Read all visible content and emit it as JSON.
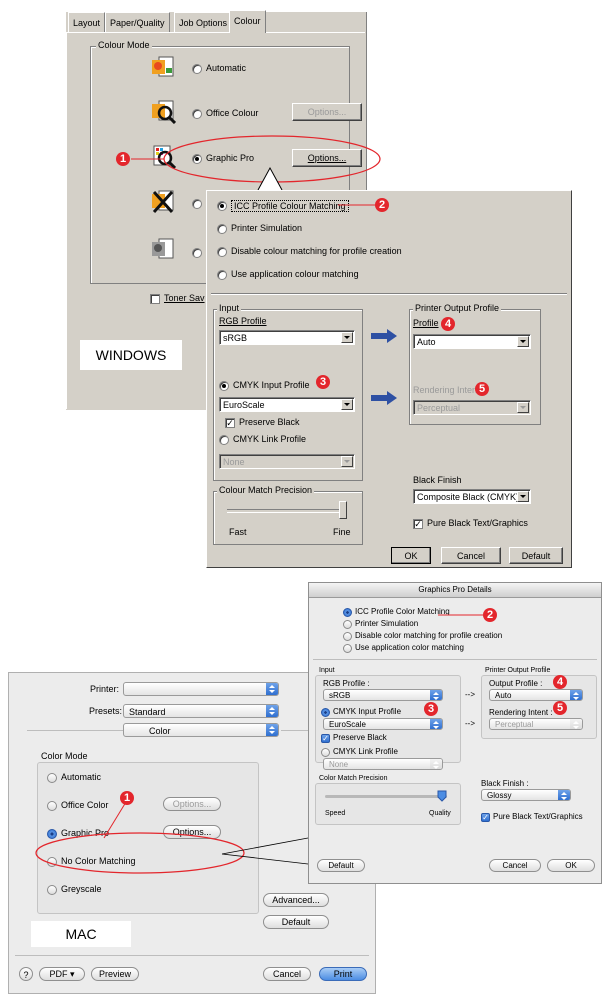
{
  "windows": {
    "tabs": [
      "Layout",
      "Paper/Quality",
      "Job Options",
      "Colour"
    ],
    "colour_mode_label": "Colour Mode",
    "automatic": "Automatic",
    "office_colour": "Office Colour",
    "graphic_pro": "Graphic Pro",
    "options": "Options...",
    "toner_saving": "Toner Sav",
    "platform_label": "WINDOWS",
    "details": {
      "icc": "ICC Profile Colour Matching",
      "printer_sim": "Printer Simulation",
      "disable": "Disable colour matching for profile creation",
      "use_app": "Use application colour matching",
      "input_label": "Input",
      "rgb_profile_label": "RGB Profile",
      "rgb_profile_value": "sRGB",
      "cmyk_input_label": "CMYK Input Profile",
      "cmyk_input_value": "EuroScale",
      "preserve_black": "Preserve Black",
      "cmyk_link_label": "CMYK Link Profile",
      "cmyk_link_value": "None",
      "precision_label": "Colour Match Precision",
      "fast": "Fast",
      "fine": "Fine",
      "output_label": "Printer Output Profile",
      "profile_label": "Profile",
      "profile_value": "Auto",
      "rendering_label": "Rendering Intent",
      "rendering_value": "Perceptual",
      "black_finish_label": "Black Finish",
      "black_finish_value": "Composite Black (CMYK)",
      "pure_black": "Pure Black Text/Graphics",
      "ok": "OK",
      "cancel": "Cancel",
      "default": "Default"
    }
  },
  "mac": {
    "details_title": "Graphics Pro Details",
    "icc": "ICC Profile Color Matching",
    "printer_sim": "Printer Simulation",
    "disable": "Disable color matching for profile creation",
    "use_app": "Use application color matching",
    "input_label": "Input",
    "rgb_profile_label": "RGB Profile :",
    "rgb_profile_value": "sRGB",
    "cmyk_input_label": "CMYK Input Profile",
    "cmyk_input_value": "EuroScale",
    "preserve_black": "Preserve Black",
    "cmyk_link_label": "CMYK Link Profile",
    "cmyk_link_value": "None",
    "arrow": "-->",
    "output_label": "Printer Output Profile",
    "output_profile_label": "Output Profile :",
    "output_profile_value": "Auto",
    "rendering_label": "Rendering Intent :",
    "rendering_value": "Perceptual",
    "precision_label": "Color Match Precision",
    "speed": "Speed",
    "quality": "Quality",
    "black_finish_label": "Black Finish :",
    "black_finish_value": "Glossy",
    "pure_black": "Pure Black Text/Graphics",
    "default": "Default",
    "cancel": "Cancel",
    "ok": "OK",
    "printer_label": "Printer:",
    "printer_value": "",
    "presets_label": "Presets:",
    "presets_value": "Standard",
    "pane_value": "Color",
    "color_mode_label": "Color Mode",
    "automatic": "Automatic",
    "office_color": "Office Color",
    "graphic_pro": "Graphic Pro",
    "no_color": "No Color Matching",
    "greyscale": "Greyscale",
    "options": "Options...",
    "advanced": "Advanced...",
    "default_btn": "Default",
    "help": "?",
    "pdf": "PDF ▾",
    "preview": "Preview",
    "cancel_btn": "Cancel",
    "print": "Print",
    "platform_label": "MAC"
  },
  "badges": [
    "1",
    "2",
    "3",
    "4",
    "5"
  ],
  "colors": {
    "badge": "#e3262c",
    "arrow": "#2e50a3",
    "win_face": "#d4d0c8",
    "mac_accent": "#2f6fd0"
  }
}
